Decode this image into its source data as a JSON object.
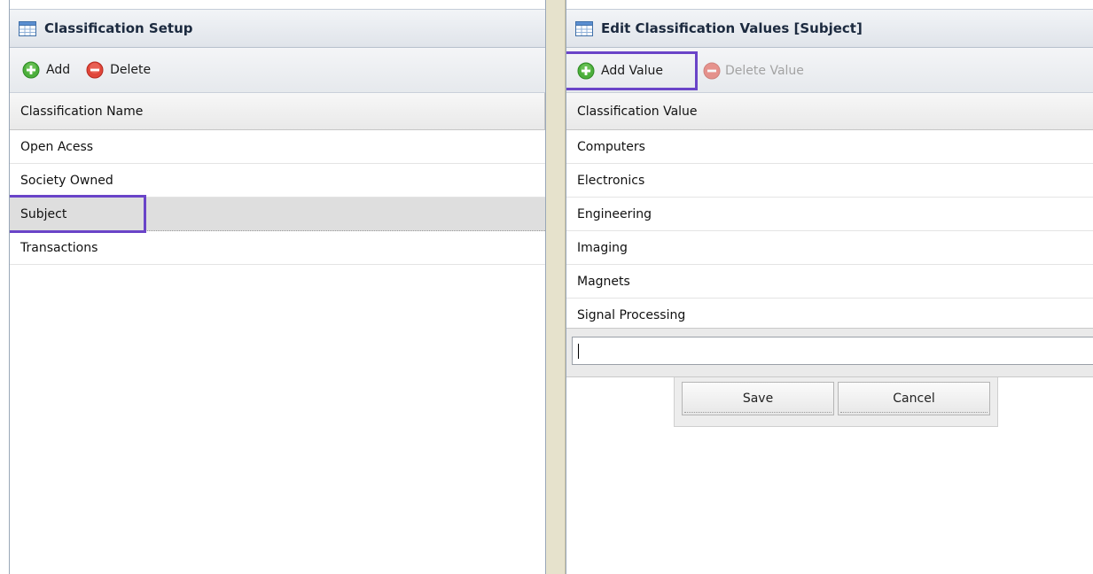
{
  "left": {
    "title": "Classification Setup",
    "toolbar": {
      "add_label": "Add",
      "delete_label": "Delete"
    },
    "column_header": "Classification Name",
    "rows": [
      "Open Acess",
      "Society Owned",
      "Subject",
      "Transactions"
    ],
    "selected_index": 2
  },
  "right": {
    "title": "Edit Classification Values [Subject]",
    "toolbar": {
      "add_value_label": "Add Value",
      "delete_value_label": "Delete Value"
    },
    "column_header": "Classification Value",
    "rows": [
      "Computers",
      "Electronics",
      "Engineering",
      "Imaging",
      "Magnets",
      "Signal Processing"
    ],
    "new_value": "",
    "save_label": "Save",
    "cancel_label": "Cancel"
  },
  "colors": {
    "highlight_outline": "#6a44c8",
    "add_icon": "#4caf3c",
    "delete_icon": "#e0463a",
    "splitter": "#e6e2cc"
  }
}
